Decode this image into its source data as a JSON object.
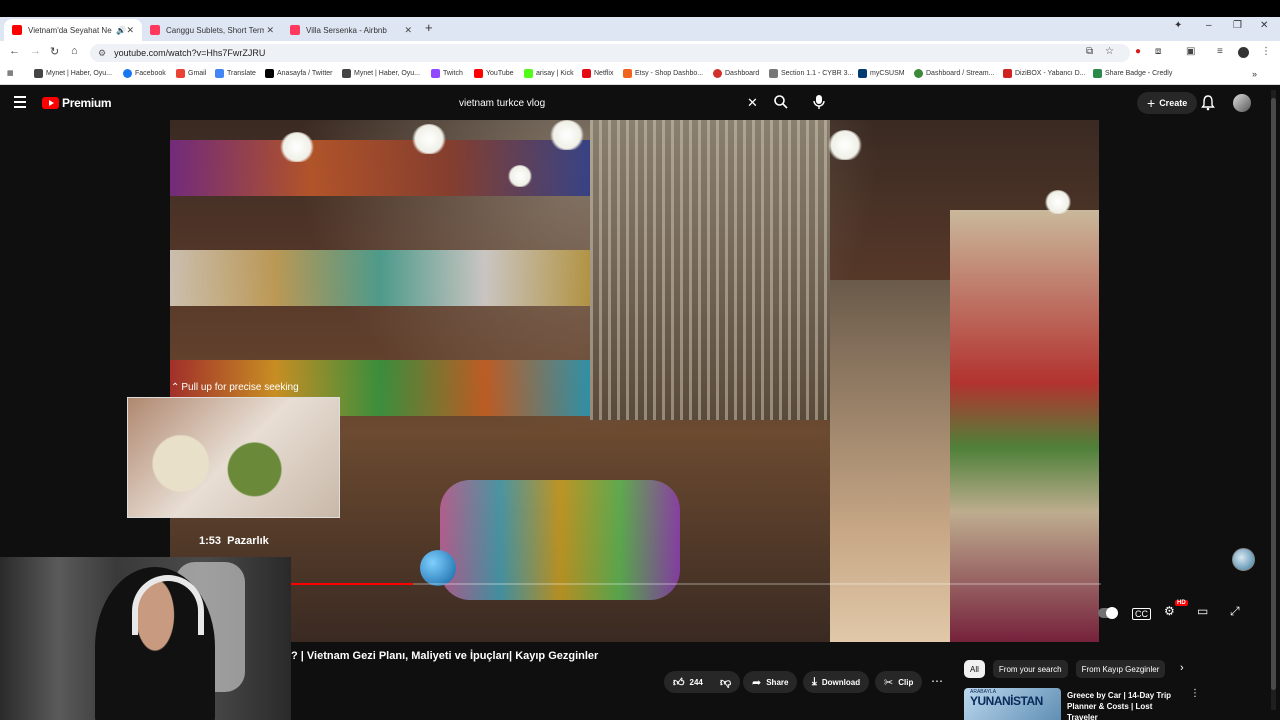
{
  "browser": {
    "tabs": [
      {
        "label": "Vietnam'da Seyahat Ne Ka",
        "favicon_color": "#ff0000",
        "active": true
      },
      {
        "label": "Canggu Sublets, Short Term Re",
        "favicon_color": "#ff385c",
        "active": false
      },
      {
        "label": "Villa Sersenka - Airbnb",
        "favicon_color": "#ff385c",
        "active": false
      }
    ],
    "address": "youtube.com/watch?v=Hhs7FwrZJRU",
    "bookmarks": [
      {
        "label": "Mynet | Haber, Oyu...",
        "color": "#444"
      },
      {
        "label": "Facebook",
        "color": "#1877f2"
      },
      {
        "label": "Gmail",
        "color": "#ea4335"
      },
      {
        "label": "Translate",
        "color": "#4285f4"
      },
      {
        "label": "Anasayfa / Twitter",
        "color": "#000"
      },
      {
        "label": "Mynet | Haber, Oyu...",
        "color": "#444"
      },
      {
        "label": "Twitch",
        "color": "#9146ff"
      },
      {
        "label": "YouTube",
        "color": "#ff0000"
      },
      {
        "label": "arisay | Kick",
        "color": "#53fc18"
      },
      {
        "label": "Netflix",
        "color": "#e50914"
      },
      {
        "label": "Etsy - Shop Dashbo...",
        "color": "#f1641e"
      },
      {
        "label": "Dashboard",
        "color": "#d0302a"
      },
      {
        "label": "Section 1.1 - CYBR 3...",
        "color": "#777"
      },
      {
        "label": "myCSUSM",
        "color": "#003a70"
      },
      {
        "label": "Dashboard / Stream...",
        "color": "#3a8a3a"
      },
      {
        "label": "DiziBOX - Yabancı D...",
        "color": "#d02020"
      },
      {
        "label": "Share Badge - Credly",
        "color": "#2a8a4a"
      }
    ]
  },
  "youtube": {
    "brand": "Premium",
    "search_value": "vietnam turkce vlog",
    "create_label": "Create",
    "accent": "#ff0000"
  },
  "player": {
    "seek_hint": "Pull up for precise seeking",
    "preview_time": "1:53",
    "preview_chapter": "Pazarlık",
    "progress_fraction": 0.15,
    "hd_badge": "HD"
  },
  "video": {
    "title": "? | Vietnam Gezi Planı, Maliyeti ve İpuçları| Kayıp Gezginler",
    "likes": "244",
    "share_label": "Share",
    "download_label": "Download",
    "clip_label": "Clip"
  },
  "sidebar": {
    "chips": [
      "All",
      "From your search",
      "From Kayıp Gezginler"
    ],
    "recommendation": {
      "thumb_text": "YUNANİSTAN",
      "thumb_sub": "ARABAYLA",
      "title": "Greece by Car | 14-Day Trip Planner & Costs | Lost Traveler"
    }
  }
}
